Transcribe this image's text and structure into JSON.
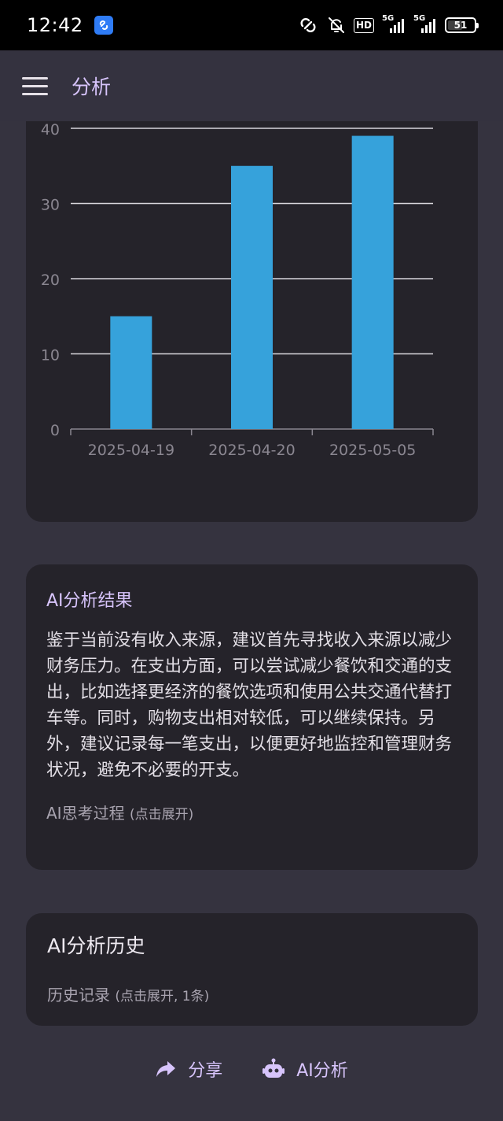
{
  "status_bar": {
    "time": "12:42",
    "hd_label": "HD",
    "signal_label_1": "5G",
    "signal_label_2": "5G",
    "battery": "51"
  },
  "app_bar": {
    "title": "分析"
  },
  "chart_data": {
    "type": "bar",
    "categories": [
      "2025-04-19",
      "2025-04-20",
      "2025-05-05"
    ],
    "values": [
      15,
      35,
      39
    ],
    "ylim": [
      0,
      40
    ],
    "yticks": [
      0,
      10,
      20,
      30,
      40
    ],
    "grid": true,
    "bar_color": "#36a2db"
  },
  "ai_result": {
    "title": "AI分析结果",
    "body": "鉴于当前没有收入来源，建议首先寻找收入来源以减少财务压力。在支出方面，可以尝试减少餐饮和交通的支出，比如选择更经济的餐饮选项和使用公共交通代替打车等。同时，购物支出相对较低，可以继续保持。另外，建议记录每一笔支出，以便更好地监控和管理财务状况，避免不必要的开支。",
    "thinking_label": "AI思考过程",
    "thinking_hint": "(点击展开)"
  },
  "history": {
    "title": "AI分析历史",
    "record_label": "历史记录",
    "record_hint": "(点击展开, 1条)"
  },
  "actions": {
    "share_label": "分享",
    "ai_label": "AI分析"
  },
  "colors": {
    "accent": "#d7c4fb",
    "background": "#35333f",
    "card": "#25232a"
  }
}
